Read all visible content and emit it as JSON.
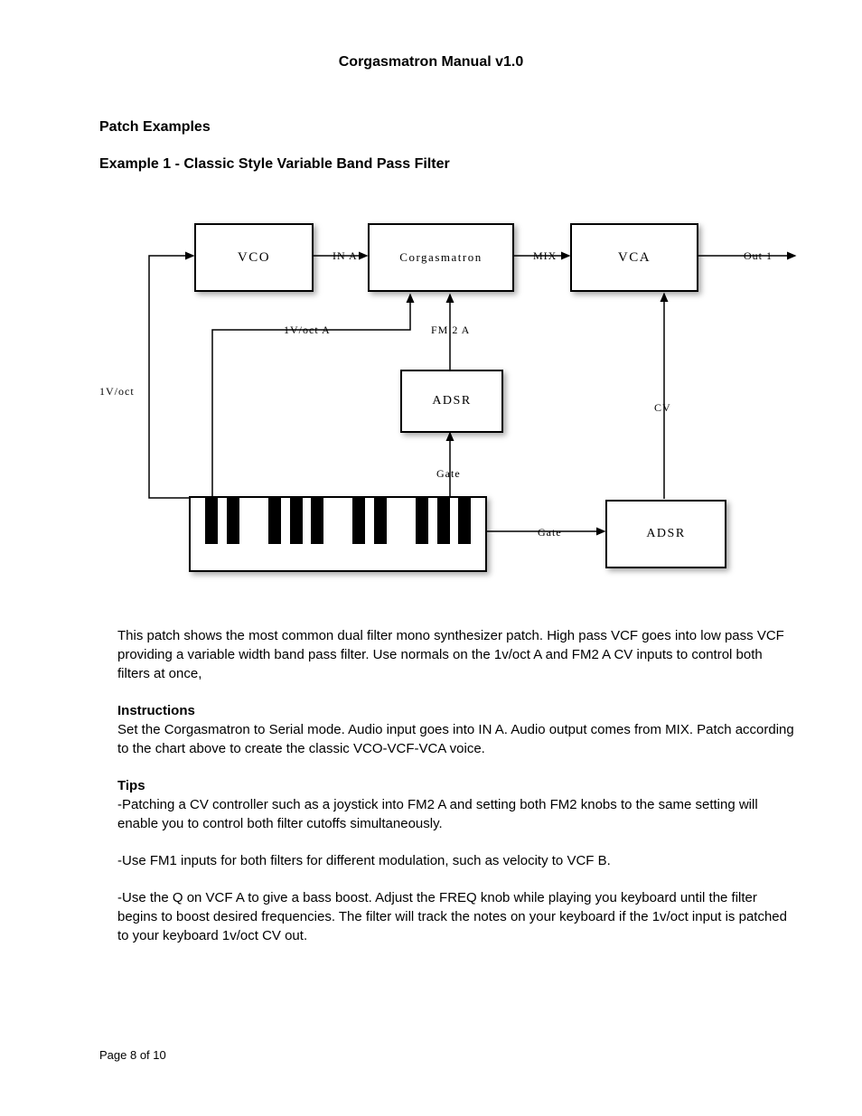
{
  "title": "Corgasmatron Manual v1.0",
  "section": "Patch Examples",
  "example_title": "Example 1 - Classic Style Variable Band Pass Filter",
  "diagram": {
    "vco": "VCO",
    "corg": "Corgasmatron",
    "vca": "VCA",
    "adsr1": "ADSR",
    "adsr2": "ADSR",
    "in_a": "IN A",
    "mix": "MIX",
    "out1": "Out 1",
    "voct_a": "1V/oct A",
    "fm2a": "FM 2 A",
    "voct": "1V/oct",
    "gate1": "Gate",
    "gate2": "Gate",
    "cv": "CV"
  },
  "para1": "This patch shows the most common dual filter mono synthesizer patch. High pass VCF goes into low pass VCF providing a variable width band pass filter. Use normals on the 1v/oct A and FM2 A CV inputs to control both filters at once,",
  "instructions_h": "Instructions",
  "instructions": "Set the Corgasmatron to Serial mode. Audio input goes into IN A. Audio output comes from MIX. Patch according to the chart above to create the classic VCO-VCF-VCA voice.",
  "tips_h": "Tips",
  "tip1": "-Patching a CV controller such as a joystick into FM2 A and setting both FM2 knobs to the same setting will enable you to control both filter cutoffs simultaneously.",
  "tip2": "-Use FM1 inputs for both filters for different modulation, such as velocity to VCF B.",
  "tip3": "-Use the Q on VCF A to give a bass boost. Adjust the FREQ knob while playing you keyboard until the filter begins to boost desired frequencies. The filter will track the notes on your keyboard if the 1v/oct input is patched to your keyboard 1v/oct CV out.",
  "footer": "Page 8 of 10"
}
